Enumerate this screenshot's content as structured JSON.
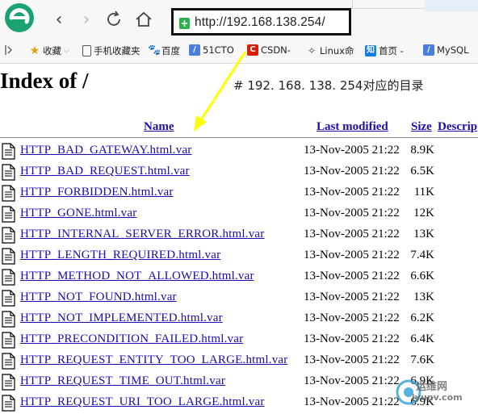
{
  "browser": {
    "url": "http://192.168.138.254/",
    "icons": {
      "logo": "browser-logo-icon",
      "back": "back-arrow-icon",
      "forward": "forward-arrow-icon",
      "reload": "reload-icon",
      "home": "home-icon",
      "secure": "shield-icon"
    }
  },
  "bookmarks": [
    {
      "label": "收藏",
      "icon": "star-icon"
    },
    {
      "label": "手机收藏夹",
      "icon": "phone-icon"
    },
    {
      "label": "百度",
      "icon": "baidu-icon"
    },
    {
      "label": "51CTO",
      "icon": "51cto-icon"
    },
    {
      "label": "CSDN-",
      "icon": "csdn-icon"
    },
    {
      "label": "Linux命",
      "icon": "linux-icon"
    },
    {
      "label": "首页 -",
      "icon": "zhihu-icon"
    },
    {
      "label": "MySQL",
      "icon": "mysql-icon"
    }
  ],
  "page": {
    "title": "Index of /",
    "annotation": "# 192. 168. 138. 254对应的目录",
    "columns": {
      "name": "Name",
      "modified": "Last modified",
      "size": "Size",
      "description": "Descrip"
    },
    "files": [
      {
        "name": "HTTP_BAD_GATEWAY.html.var",
        "modified": "13-Nov-2005 21:22",
        "size": "8.9K"
      },
      {
        "name": "HTTP_BAD_REQUEST.html.var",
        "modified": "13-Nov-2005 21:22",
        "size": "6.5K"
      },
      {
        "name": "HTTP_FORBIDDEN.html.var",
        "modified": "13-Nov-2005 21:22",
        "size": "11K"
      },
      {
        "name": "HTTP_GONE.html.var",
        "modified": "13-Nov-2005 21:22",
        "size": "12K"
      },
      {
        "name": "HTTP_INTERNAL_SERVER_ERROR.html.var",
        "modified": "13-Nov-2005 21:22",
        "size": "13K"
      },
      {
        "name": "HTTP_LENGTH_REQUIRED.html.var",
        "modified": "13-Nov-2005 21:22",
        "size": "7.4K"
      },
      {
        "name": "HTTP_METHOD_NOT_ALLOWED.html.var",
        "modified": "13-Nov-2005 21:22",
        "size": "6.6K"
      },
      {
        "name": "HTTP_NOT_FOUND.html.var",
        "modified": "13-Nov-2005 21:22",
        "size": "13K"
      },
      {
        "name": "HTTP_NOT_IMPLEMENTED.html.var",
        "modified": "13-Nov-2005 21:22",
        "size": "6.2K"
      },
      {
        "name": "HTTP_PRECONDITION_FAILED.html.var",
        "modified": "13-Nov-2005 21:22",
        "size": "6.4K"
      },
      {
        "name": "HTTP_REQUEST_ENTITY_TOO_LARGE.html.var",
        "modified": "13-Nov-2005 21:22",
        "size": "7.6K"
      },
      {
        "name": "HTTP_REQUEST_TIME_OUT.html.var",
        "modified": "13-Nov-2005 21:22",
        "size": "6.9K"
      },
      {
        "name": "HTTP_REQUEST_URI_TOO_LARGE.html.var",
        "modified": "13-Nov-2005 21:22",
        "size": "6.9K"
      }
    ]
  },
  "watermark": {
    "line1": "运维网",
    "line2": "iyunv.com"
  },
  "colors": {
    "link": "#1a0dab",
    "arrow": "#ffff00",
    "logo": "#1aa36e"
  }
}
